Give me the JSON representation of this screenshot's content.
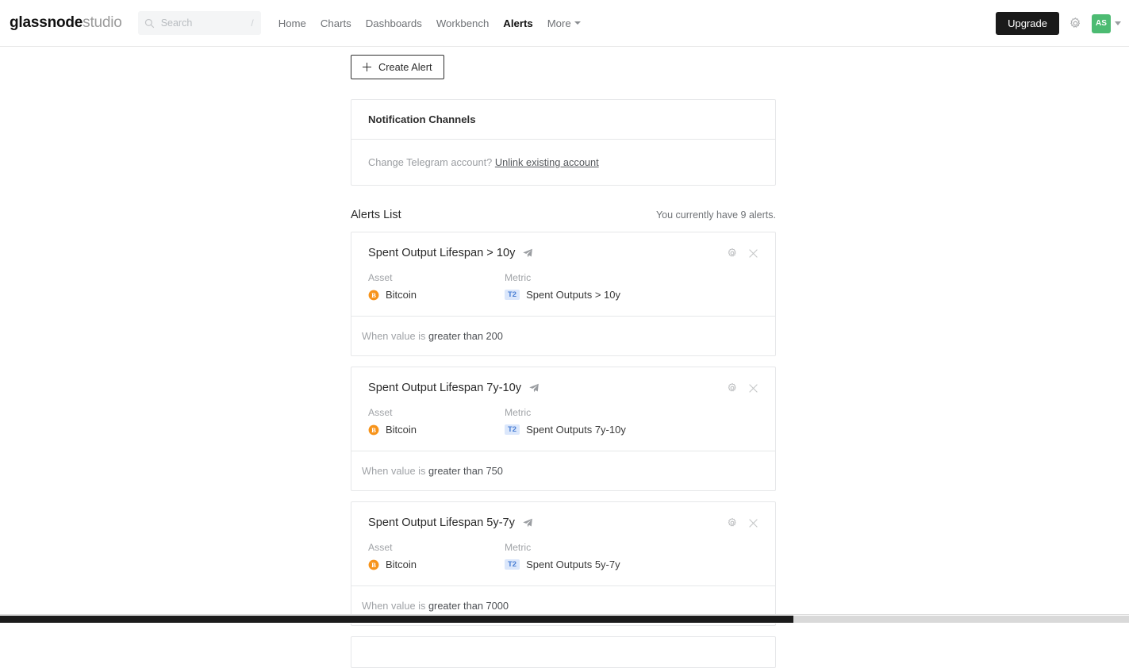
{
  "header": {
    "logo_bold": "glassnode",
    "logo_light": "studio",
    "search": {
      "placeholder": "Search",
      "shortcut": "/",
      "icon": "search-icon"
    },
    "nav": [
      {
        "label": "Home",
        "active": false
      },
      {
        "label": "Charts",
        "active": false
      },
      {
        "label": "Dashboards",
        "active": false
      },
      {
        "label": "Workbench",
        "active": false
      },
      {
        "label": "Alerts",
        "active": true
      },
      {
        "label": "More",
        "active": false,
        "icon": "chevron-down-icon"
      }
    ],
    "upgrade_label": "Upgrade",
    "settings_icon": "gear-icon",
    "avatar_initials": "AS",
    "avatar_color": "#4cbb72",
    "avatar_chevron": "chevron-down-icon"
  },
  "main": {
    "create_alert_label": "Create Alert",
    "notification_channels": {
      "title": "Notification Channels",
      "change_text": "Change Telegram account?",
      "unlink_link": "Unlink existing account"
    },
    "alerts_list": {
      "title": "Alerts List",
      "count_text": "You currently have 9 alerts.",
      "field_labels": {
        "asset": "Asset",
        "metric": "Metric"
      },
      "condition_prefix": "When value is ",
      "items": [
        {
          "title": "Spent Output Lifespan > 10y",
          "channel_icon": "telegram-send-icon",
          "asset": "Bitcoin",
          "asset_icon": "bitcoin-icon",
          "metric_badge": "T2",
          "metric": "Spent Outputs > 10y",
          "condition": "greater than 200"
        },
        {
          "title": "Spent Output Lifespan 7y-10y",
          "channel_icon": "telegram-send-icon",
          "asset": "Bitcoin",
          "asset_icon": "bitcoin-icon",
          "metric_badge": "T2",
          "metric": "Spent Outputs 7y-10y",
          "condition": "greater than 750"
        },
        {
          "title": "Spent Output Lifespan 5y-7y",
          "channel_icon": "telegram-send-icon",
          "asset": "Bitcoin",
          "asset_icon": "bitcoin-icon",
          "metric_badge": "T2",
          "metric": "Spent Outputs 5y-7y",
          "condition": "greater than 7000"
        }
      ]
    }
  },
  "colors": {
    "accent_blue": "#4a7fd4",
    "bitcoin_orange": "#f7931a",
    "avatar_green": "#4cbb72",
    "upgrade_black": "#1a1a1a"
  }
}
